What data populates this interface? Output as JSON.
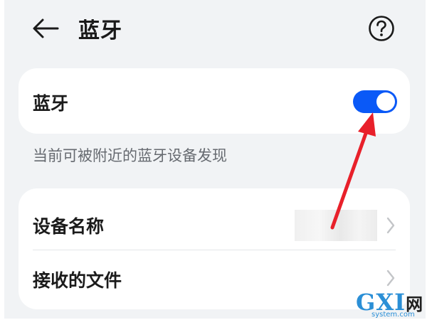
{
  "header": {
    "title": "蓝牙"
  },
  "bluetooth_card": {
    "label": "蓝牙",
    "toggle_on": true,
    "toggle_color": "#0a59f7"
  },
  "hint": "当前可被附近的蓝牙设备发现",
  "list": {
    "items": [
      {
        "label": "设备名称",
        "value": ""
      },
      {
        "label": "接收的文件"
      }
    ]
  },
  "icons": {
    "back": "arrow-left-icon",
    "help": "question-circle-icon",
    "chevron": "chevron-right-icon"
  },
  "annotation": {
    "arrow_color": "#e8202a"
  },
  "watermark": {
    "text": "GXI",
    "suffix": "网",
    "domain": "system.com"
  }
}
